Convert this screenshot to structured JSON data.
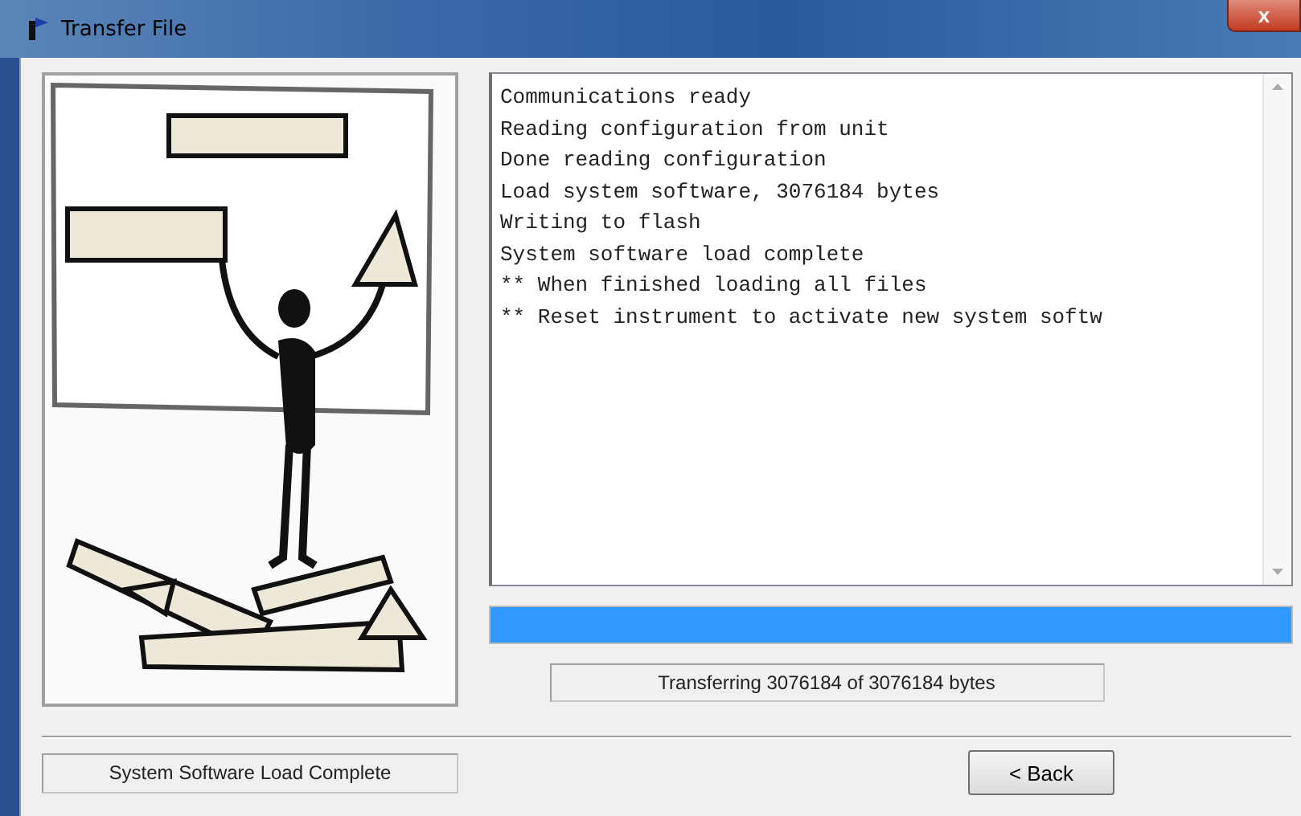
{
  "window": {
    "title": "Transfer File",
    "close_label": "x"
  },
  "log": {
    "lines": [
      "Communications ready",
      "Reading configuration from unit",
      "Done reading configuration",
      "Load system software, 3076184 bytes",
      "Writing to flash",
      "System software load complete",
      "** When finished loading all files",
      "** Reset instrument to activate new system softw"
    ]
  },
  "progress": {
    "level": 1,
    "status": "Transferring 3076184 of 3076184 bytes"
  },
  "status_bar": {
    "text": "System Software Load Complete"
  },
  "buttons": [
    {
      "label": "< Back",
      "disabled": false
    }
  ]
}
